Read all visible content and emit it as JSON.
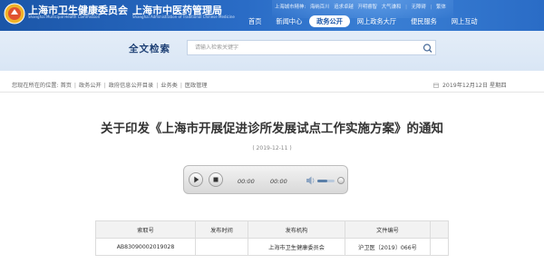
{
  "header": {
    "site_name": "上海市卫生健康委员会",
    "site_name_en": "Shanghai Municipal Health Commission",
    "site_name2": "上海市中医药管理局",
    "site_name2_en": "Shanghai Administration of Traditional Chinese Medicine",
    "top_links": [
      "上海城市精神:",
      "海纳百川",
      "追求卓越",
      "开明睿智",
      "大气谦和",
      "|",
      "无障碍",
      "|",
      "繁体"
    ],
    "nav": [
      {
        "label": "首页",
        "active": false
      },
      {
        "label": "新闻中心",
        "active": false
      },
      {
        "label": "政务公开",
        "active": true
      },
      {
        "label": "网上政务大厅",
        "active": false
      },
      {
        "label": "便民服务",
        "active": false
      },
      {
        "label": "网上互动",
        "active": false
      }
    ]
  },
  "search": {
    "title": "全文检索",
    "placeholder": "请输入检索关键字"
  },
  "breadcrumb": {
    "prefix": "您现在所在的位置:",
    "items": [
      "首页",
      "政务公开",
      "政府信息公开目录",
      "业务类",
      "医政管理"
    ],
    "date": "2019年12月12日 星期四"
  },
  "article": {
    "title": "关于印发《上海市开展促进诊所发展试点工作实施方案》的通知",
    "date": "( 2019-12-11 )"
  },
  "player": {
    "current_time": "00:00",
    "total_time": "00:00",
    "volume": 0.6
  },
  "table": {
    "headers": [
      "索取号",
      "发布时间",
      "发布机构",
      "文件编号",
      ""
    ],
    "row": [
      "AB83090002019028",
      "",
      "上海市卫生健康委员会",
      "沪卫医〔2019〕066号",
      ""
    ]
  },
  "colors": {
    "header_blue": "#1b56a8",
    "search_band": "#dfe9f6",
    "active_nav_text": "#1b56a8"
  }
}
